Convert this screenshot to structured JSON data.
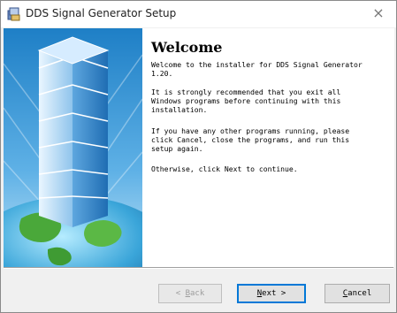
{
  "window": {
    "title": "DDS Signal Generator Setup",
    "close_glyph": "×"
  },
  "content": {
    "heading": "Welcome",
    "paragraphs": [
      "Welcome to the installer for DDS Signal Generator\n1.20.",
      "It is strongly recommended that you exit all\nWindows programs before continuing with this\ninstallation.",
      "If you have any other programs running, please\nclick Cancel, close the programs, and run this\nsetup again.",
      "Otherwise, click Next to continue."
    ]
  },
  "buttons": {
    "back": {
      "prefix": "< ",
      "accel": "B",
      "rest": "ack"
    },
    "next": {
      "accel": "N",
      "rest": "ext >"
    },
    "cancel": {
      "accel": "C",
      "rest": "ancel"
    }
  },
  "icons": {
    "app": "installer-icon",
    "close": "close-icon"
  },
  "colors": {
    "content_bg": "#ffffff",
    "dialog_bg": "#f0f0f0",
    "default_button_border": "#0078d7"
  }
}
